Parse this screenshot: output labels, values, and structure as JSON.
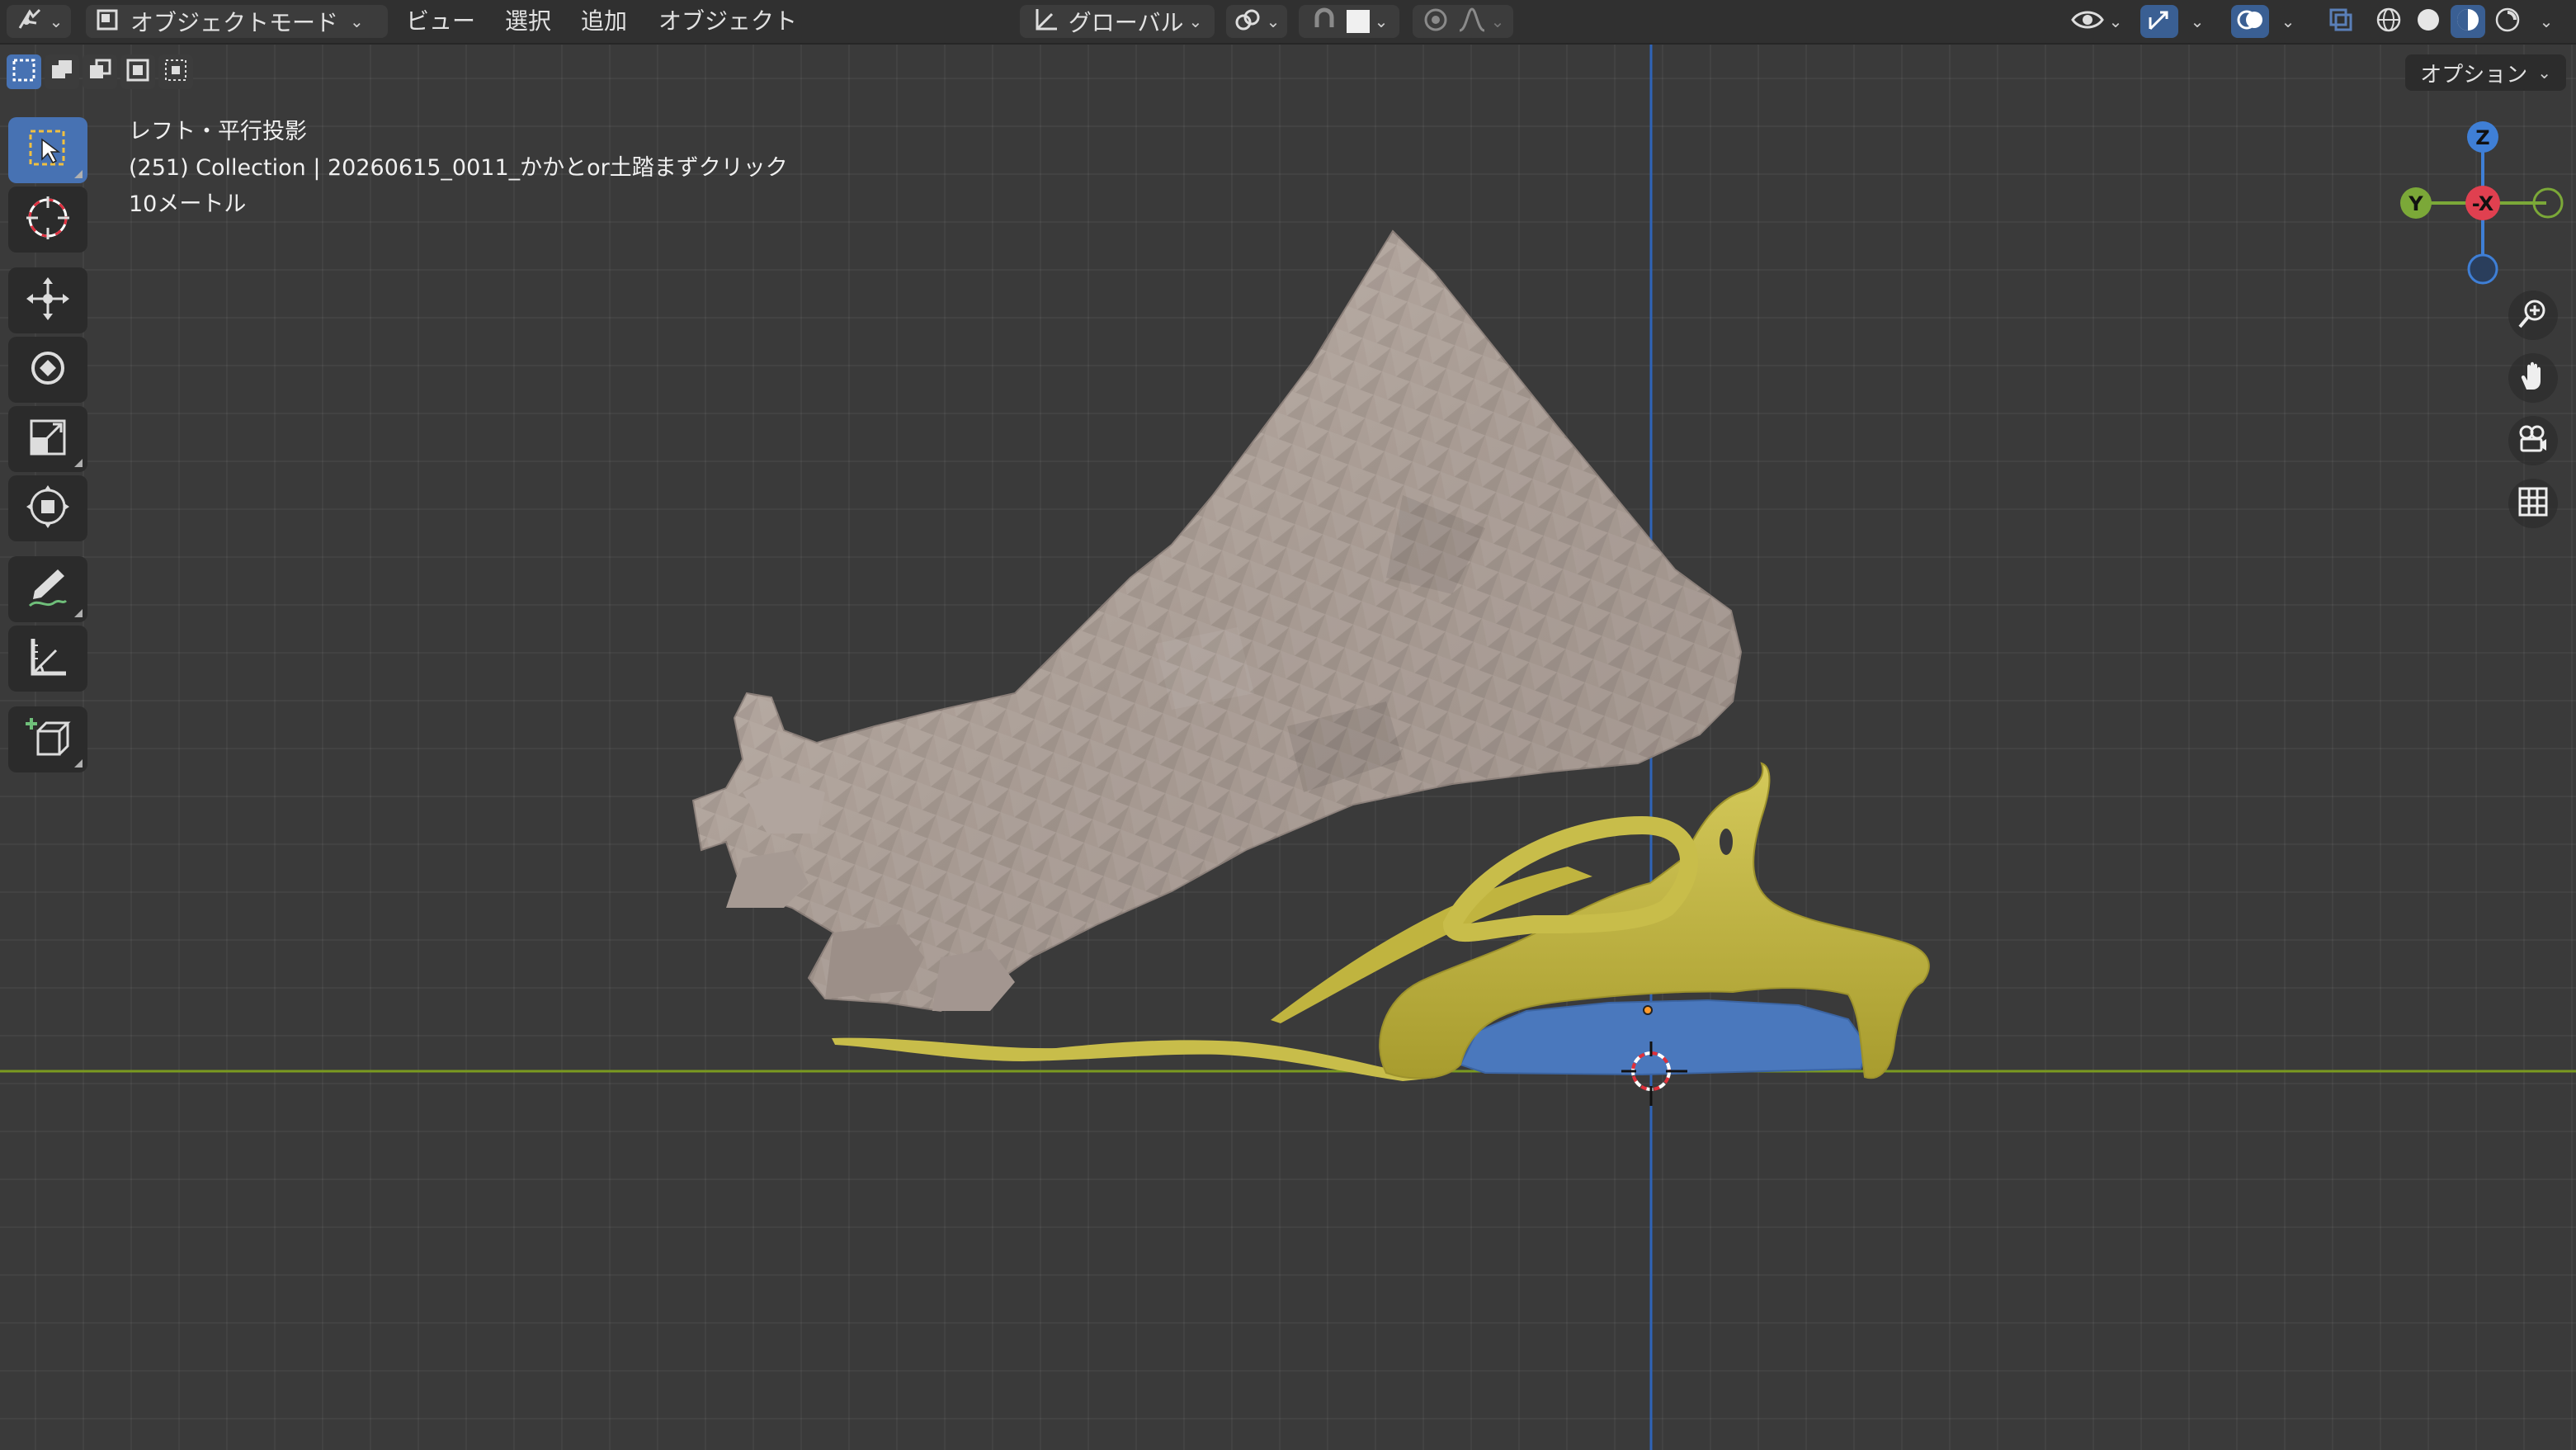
{
  "header": {
    "mode_label": "オブジェクトモード",
    "menus": [
      "ビュー",
      "選択",
      "追加",
      "オブジェクト"
    ],
    "transform_orientation": "グローバル"
  },
  "options_label": "オプション",
  "viewport": {
    "view_name": "レフト・平行投影",
    "collection_info": "(251) Collection | 20260615_0011_かかとor土踏まずクリック",
    "scale_label": "10メートル"
  },
  "gizmo": {
    "z_label": "Z",
    "y_label": "Y",
    "x_label": "-X"
  },
  "colors": {
    "foot": "#b0a49c",
    "insole_yellow": "#c8bd4a",
    "insole_blue": "#4a78bd",
    "axis_green": "#7a9a20",
    "axis_blue": "#2f64b8"
  }
}
